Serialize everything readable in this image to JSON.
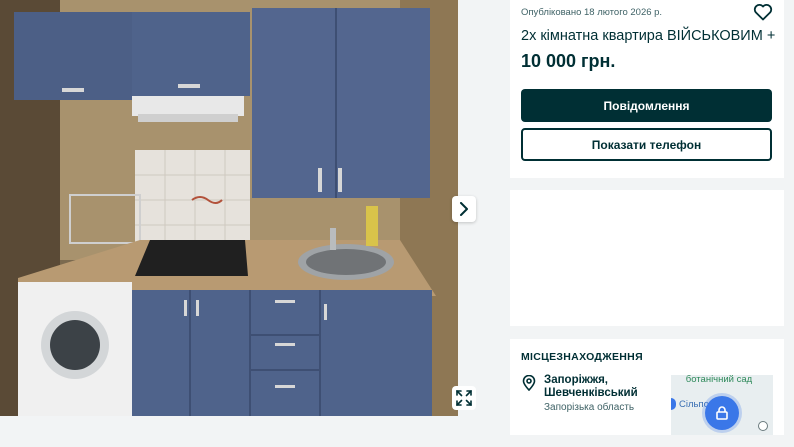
{
  "listing": {
    "posted": "Опубліковано 18 лютого 2026 р.",
    "title": "2х кімнатна квартира ВІЙСЬКОВИМ +",
    "price": "10 000 грн.",
    "message_label": "Повідомлення",
    "phone_label": "Показати телефон"
  },
  "gallery": {
    "next_icon": "chevron-right-icon",
    "expand_icon": "expand-icon"
  },
  "location": {
    "heading": "МІСЦЕЗНАХОДЖЕННЯ",
    "city": "Запоріжжя, Шевченківський",
    "region": "Запорізька область",
    "map_label_1": "ботанічний сад",
    "map_label_2": "Сільпо"
  },
  "colors": {
    "primary": "#002f34",
    "background": "#f2f4f5",
    "map_pin": "#3a77e8"
  }
}
